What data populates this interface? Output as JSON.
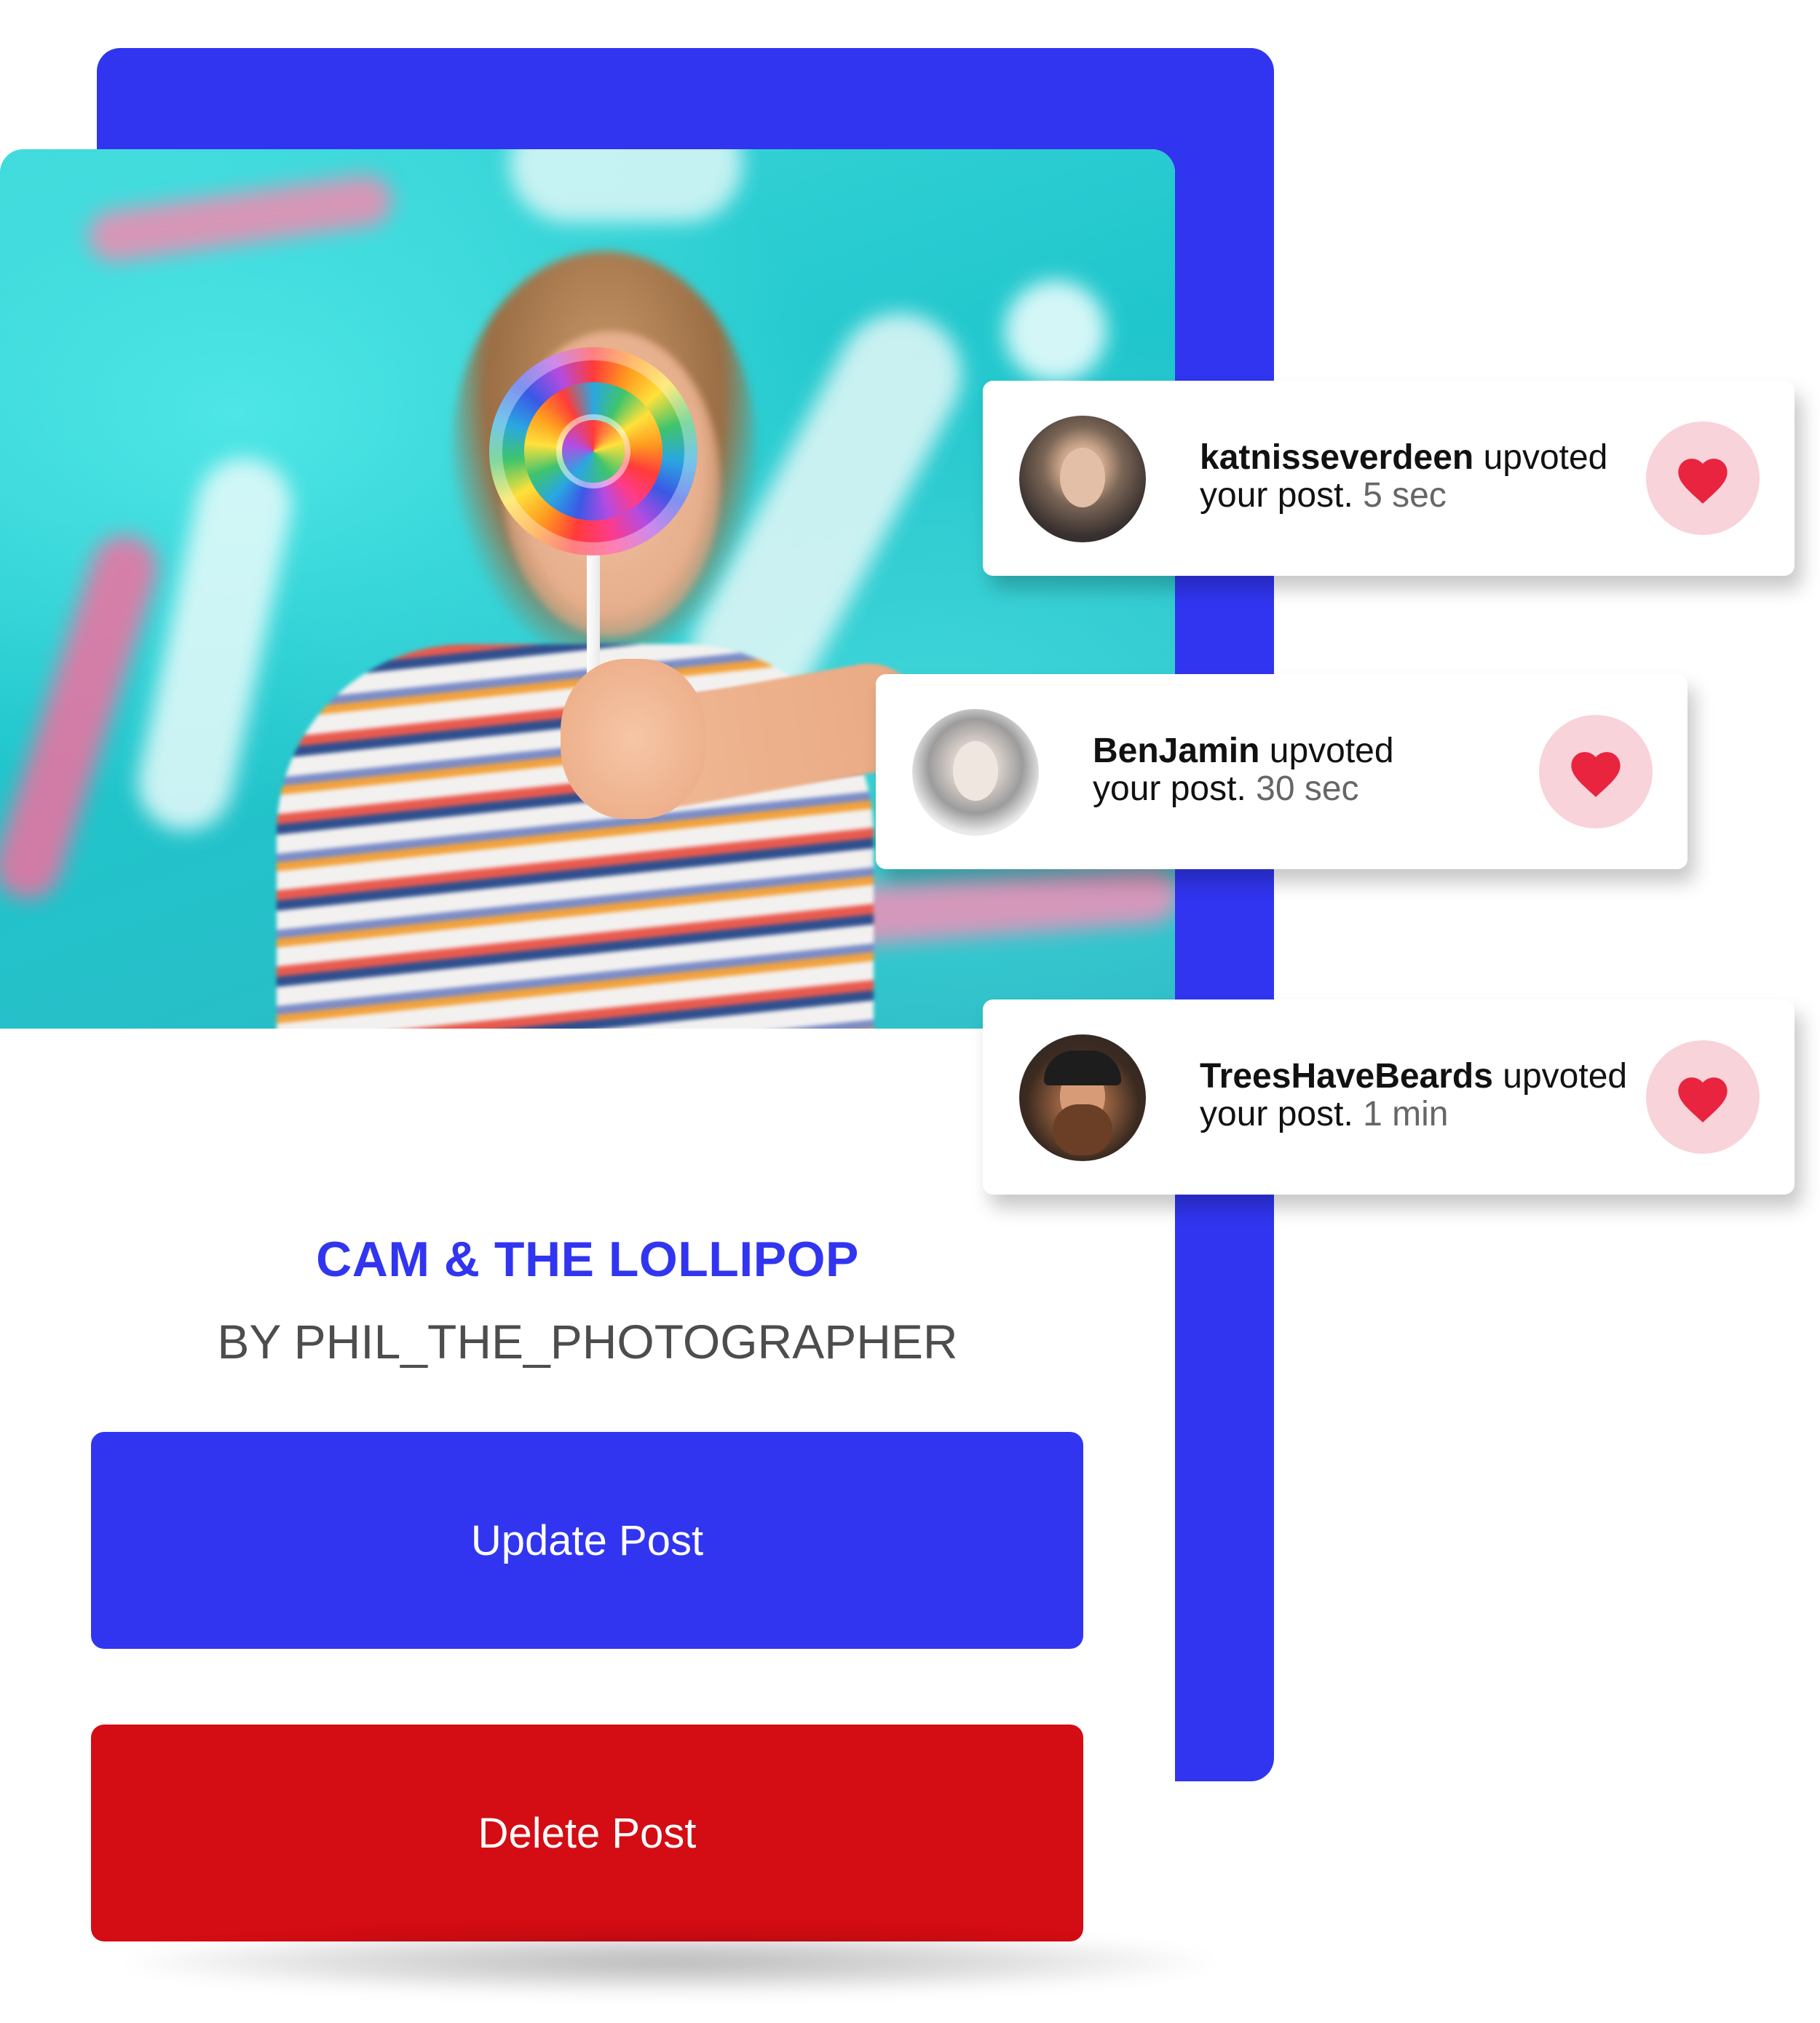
{
  "post": {
    "title": "CAM & THE LOLLIPOP",
    "author": "BY PHIL_THE_PHOTOGRAPHER"
  },
  "actions": {
    "update_label": "Update Post",
    "delete_label": "Delete Post"
  },
  "notifications": [
    {
      "user": "katnisseverdeen",
      "action": "upvoted",
      "message": "your post.",
      "time": "5 sec",
      "icon": "heart-icon"
    },
    {
      "user": "BenJamin",
      "action": "upvoted",
      "message": "your post.",
      "time": "30 sec",
      "icon": "heart-icon"
    },
    {
      "user": "TreesHaveBeards",
      "action": "upvoted",
      "message": "your post.",
      "time": "1 min",
      "icon": "heart-icon"
    }
  ],
  "colors": {
    "brand_blue": "#3135F0",
    "delete_red": "#D40C13",
    "heart_red": "#E8243F",
    "heart_bg": "#F8D3DA"
  }
}
